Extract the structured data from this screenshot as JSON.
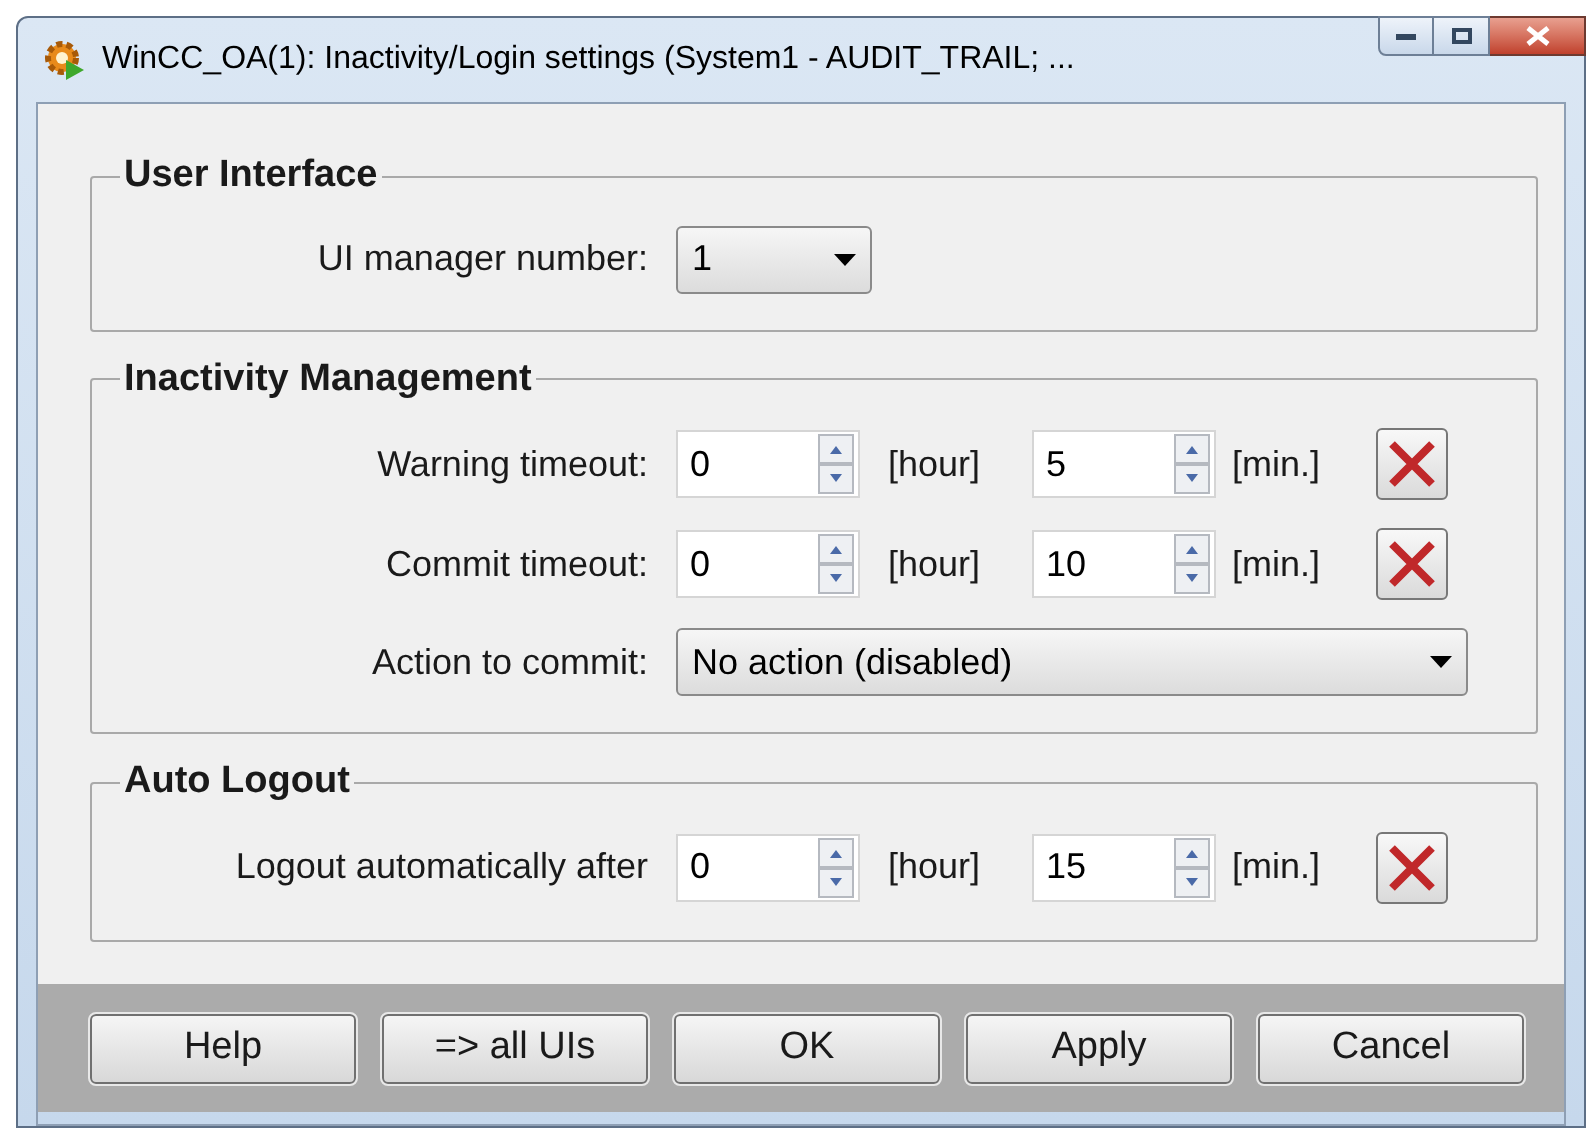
{
  "window": {
    "title": "WinCC_OA(1): Inactivity/Login settings (System1 - AUDIT_TRAIL; ..."
  },
  "groups": [
    {
      "title": "User Interface",
      "rows": [
        {
          "kind": "short_dropdown",
          "label": "UI manager number:",
          "value": "1"
        }
      ]
    },
    {
      "title": "Inactivity Management",
      "rows": [
        {
          "kind": "timeout",
          "label": "Warning timeout:",
          "hours": "0",
          "hour_unit": "[hour]",
          "minutes": "5",
          "minute_unit": "[min.]"
        },
        {
          "kind": "timeout",
          "label": "Commit timeout:",
          "hours": "0",
          "hour_unit": "[hour]",
          "minutes": "10",
          "minute_unit": "[min.]"
        },
        {
          "kind": "wide_dropdown",
          "label": "Action to commit:",
          "value": "No action (disabled)"
        }
      ]
    },
    {
      "title": "Auto Logout",
      "rows": [
        {
          "kind": "timeout",
          "label": "Logout automatically after",
          "hours": "0",
          "hour_unit": "[hour]",
          "minutes": "15",
          "minute_unit": "[min.]"
        }
      ]
    }
  ],
  "buttons": [
    "Help",
    "=> all UIs",
    "OK",
    "Apply",
    "Cancel"
  ]
}
